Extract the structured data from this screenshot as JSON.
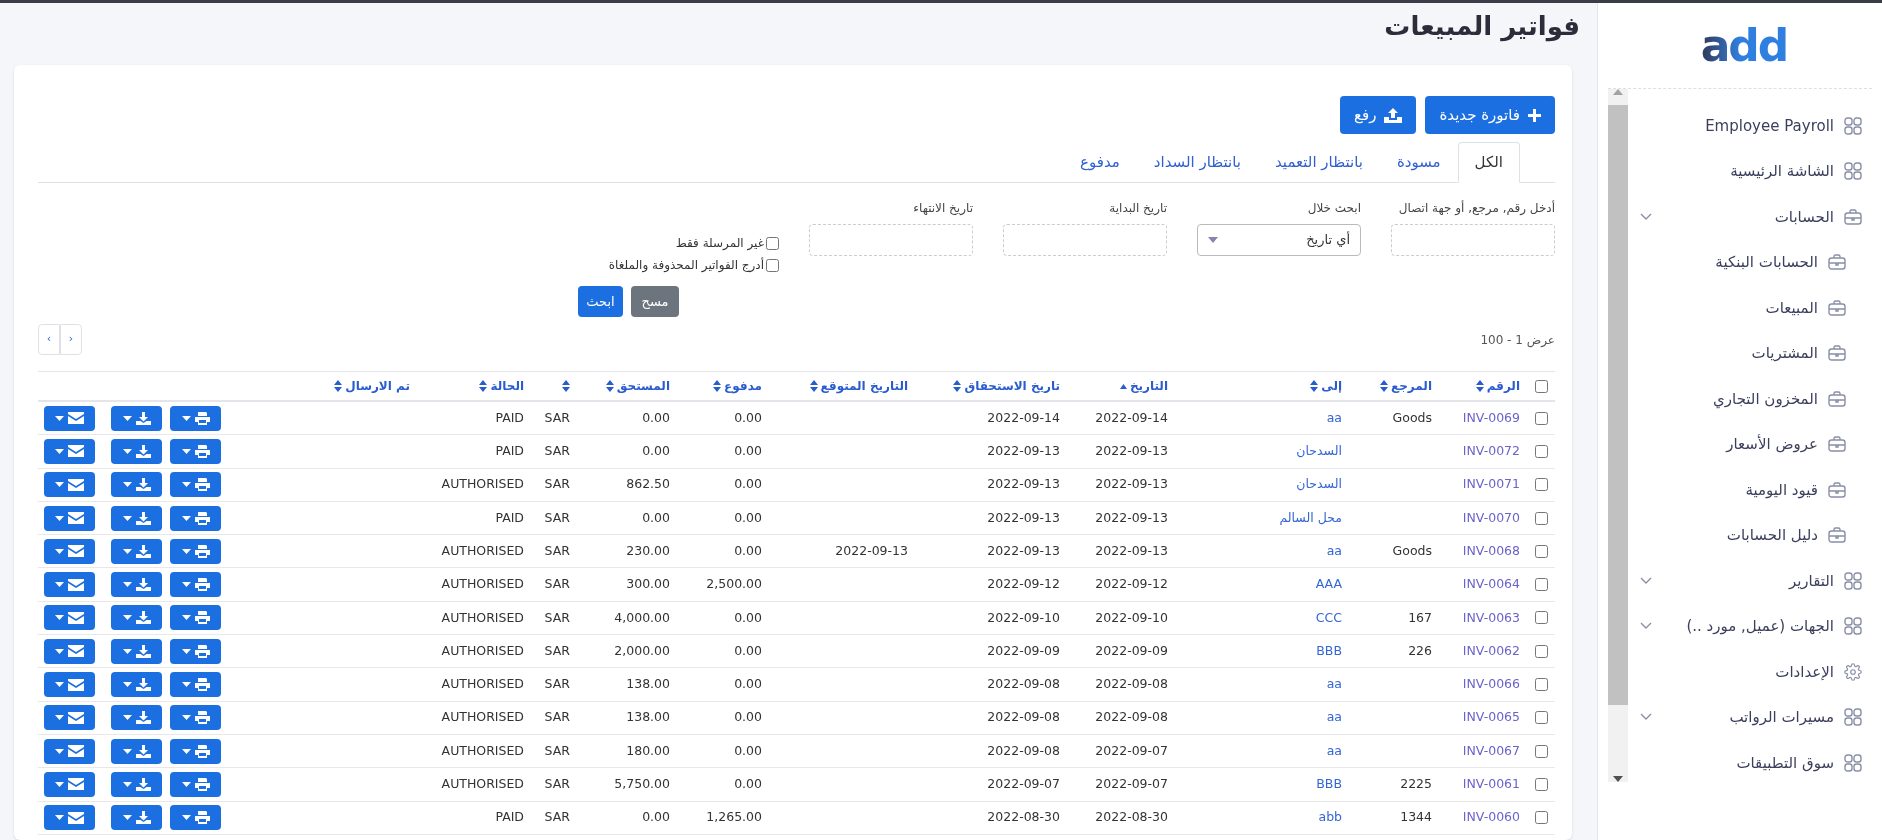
{
  "logo": "add",
  "page_title": "فواتير المبيعات",
  "sidebar": {
    "items": [
      {
        "label": "Employee Payroll",
        "kind": "module",
        "has_submenu": false
      },
      {
        "label": "الشاشة الرئيسية",
        "kind": "module",
        "has_submenu": false
      },
      {
        "label": "الحسابات",
        "kind": "ledger",
        "has_submenu": true,
        "children": [
          {
            "label": "الحسابات البنكية",
            "kind": "ledger"
          },
          {
            "label": "المبيعات",
            "kind": "ledger"
          },
          {
            "label": "المشتريات",
            "kind": "ledger"
          },
          {
            "label": "المخزون التجاري",
            "kind": "ledger"
          },
          {
            "label": "عروض الأسعار",
            "kind": "ledger"
          },
          {
            "label": "قيود اليومية",
            "kind": "ledger"
          },
          {
            "label": "دليل الحسابات",
            "kind": "ledger"
          }
        ]
      },
      {
        "label": "التقارير",
        "kind": "module",
        "has_submenu": true
      },
      {
        "label": "الجهات (عميل, مورد ..)",
        "kind": "module",
        "has_submenu": true
      },
      {
        "label": "الإعدادات",
        "kind": "settings",
        "has_submenu": false
      },
      {
        "label": "مسيرات الرواتب",
        "kind": "module",
        "has_submenu": true
      },
      {
        "label": "سوق التطبيقات",
        "kind": "module",
        "has_submenu": false
      }
    ]
  },
  "actions": [
    {
      "label": "فاتورة جديدة",
      "kind": "new"
    },
    {
      "label": "رفع",
      "kind": "upload"
    }
  ],
  "tabs": [
    {
      "label": "الكل",
      "selected": true
    },
    {
      "label": "مسودة",
      "selected": false
    },
    {
      "label": "بانتظار التعميد",
      "selected": false
    },
    {
      "label": "بانتظار السداد",
      "selected": false
    },
    {
      "label": "مدفوع",
      "selected": false
    }
  ],
  "filters": {
    "search": {
      "label": "أدخل رقم, مرجع, أو جهة اتصال"
    },
    "range": {
      "label": "ابحث خلال",
      "value": "أي تاريخ"
    },
    "start_date": {
      "label": "تاريخ البداية"
    },
    "end_date": {
      "label": "تاريخ الانتهاء"
    },
    "options": [
      {
        "label": "غير المرسلة فقط",
        "checked": false
      },
      {
        "label": "أدرج الفواتير المحذوفة والملغاة",
        "checked": false
      }
    ],
    "clear_button": "مسح",
    "search_button": "ابحث"
  },
  "range_text": "عرض 1 - 100",
  "pagination": {
    "previous": "‹",
    "next": "›"
  },
  "table": {
    "select_all_checked": false,
    "columns": [
      {
        "label": "الرقم",
        "sorted": false
      },
      {
        "label": "المرجع",
        "sorted": false
      },
      {
        "label": "إلى",
        "sorted": false
      },
      {
        "label": "التاريخ",
        "sorted": true
      },
      {
        "label": "تاريخ الاستحقاق",
        "sorted": false
      },
      {
        "label": "التاريخ المتوقع",
        "sorted": false
      },
      {
        "label": "مدفوع",
        "sorted": false
      },
      {
        "label": "المستحق",
        "sorted": false
      },
      {
        "sorted": false
      },
      {
        "label": "الحالة",
        "sorted": false
      },
      {
        "label": "تم الارسال",
        "sorted": false
      }
    ],
    "rows": [
      {
        "checked": false,
        "number": "INV-0069",
        "reference": "Goods",
        "to": "aa",
        "date": "2022-09-14",
        "due_date": "2022-09-14",
        "paid": "0.00",
        "due": "0.00",
        "currency": "SAR",
        "status": "PAID"
      },
      {
        "checked": false,
        "number": "INV-0072",
        "to": "السدحان",
        "date": "2022-09-13",
        "due_date": "2022-09-13",
        "paid": "0.00",
        "due": "0.00",
        "currency": "SAR",
        "status": "PAID"
      },
      {
        "checked": false,
        "number": "INV-0071",
        "to": "السدحان",
        "date": "2022-09-13",
        "due_date": "2022-09-13",
        "paid": "0.00",
        "due": "862.50",
        "currency": "SAR",
        "status": "AUTHORISED"
      },
      {
        "checked": false,
        "number": "INV-0070",
        "to": "محل السالم",
        "date": "2022-09-13",
        "due_date": "2022-09-13",
        "paid": "0.00",
        "due": "0.00",
        "currency": "SAR",
        "status": "PAID"
      },
      {
        "checked": false,
        "number": "INV-0068",
        "reference": "Goods",
        "to": "aa",
        "date": "2022-09-13",
        "due_date": "2022-09-13",
        "expected_date": "2022-09-13",
        "paid": "0.00",
        "due": "230.00",
        "currency": "SAR",
        "status": "AUTHORISED"
      },
      {
        "checked": false,
        "number": "INV-0064",
        "to": "AAA",
        "date": "2022-09-12",
        "due_date": "2022-09-12",
        "paid": "2,500.00",
        "due": "300.00",
        "currency": "SAR",
        "status": "AUTHORISED"
      },
      {
        "checked": false,
        "number": "INV-0063",
        "reference": "167",
        "to": "CCC",
        "date": "2022-09-10",
        "due_date": "2022-09-10",
        "paid": "0.00",
        "due": "4,000.00",
        "currency": "SAR",
        "status": "AUTHORISED"
      },
      {
        "checked": false,
        "number": "INV-0062",
        "reference": "226",
        "to": "BBB",
        "date": "2022-09-09",
        "due_date": "2022-09-09",
        "paid": "0.00",
        "due": "2,000.00",
        "currency": "SAR",
        "status": "AUTHORISED"
      },
      {
        "checked": false,
        "number": "INV-0066",
        "to": "aa",
        "date": "2022-09-08",
        "due_date": "2022-09-08",
        "paid": "0.00",
        "due": "138.00",
        "currency": "SAR",
        "status": "AUTHORISED"
      },
      {
        "checked": false,
        "number": "INV-0065",
        "to": "aa",
        "date": "2022-09-08",
        "due_date": "2022-09-08",
        "paid": "0.00",
        "due": "138.00",
        "currency": "SAR",
        "status": "AUTHORISED"
      },
      {
        "checked": false,
        "number": "INV-0067",
        "to": "aa",
        "date": "2022-09-07",
        "due_date": "2022-09-08",
        "paid": "0.00",
        "due": "180.00",
        "currency": "SAR",
        "status": "AUTHORISED"
      },
      {
        "checked": false,
        "number": "INV-0061",
        "reference": "2225",
        "to": "BBB",
        "date": "2022-09-07",
        "due_date": "2022-09-07",
        "paid": "0.00",
        "due": "5,750.00",
        "currency": "SAR",
        "status": "AUTHORISED"
      },
      {
        "checked": false,
        "number": "INV-0060",
        "reference": "1344",
        "to": "abb",
        "date": "2022-08-30",
        "due_date": "2022-08-30",
        "paid": "1,265.00",
        "due": "0.00",
        "currency": "SAR",
        "status": "PAID"
      }
    ]
  }
}
